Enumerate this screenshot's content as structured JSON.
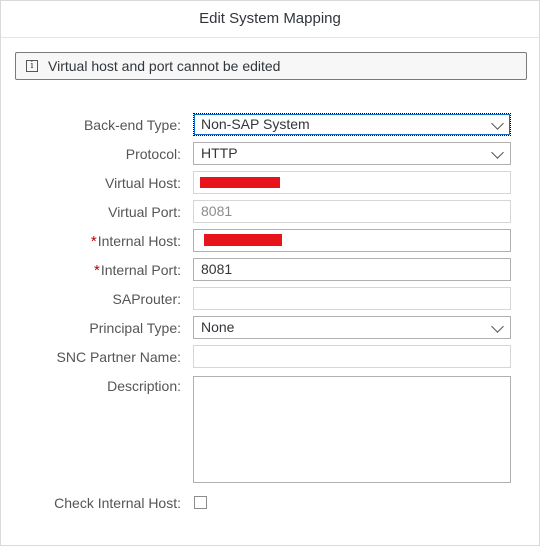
{
  "dialog": {
    "title": "Edit System Mapping",
    "info": {
      "icon": "info-icon",
      "text": "Virtual host and port cannot be edited"
    }
  },
  "form": {
    "backend_type": {
      "label": "Back-end Type:",
      "value": "Non-SAP System"
    },
    "protocol": {
      "label": "Protocol:",
      "value": "HTTP"
    },
    "virtual_host": {
      "label": "Virtual Host:",
      "value": ""
    },
    "virtual_port": {
      "label": "Virtual Port:",
      "value": "8081"
    },
    "internal_host": {
      "label": "Internal Host:",
      "required": "*",
      "value": ""
    },
    "internal_port": {
      "label": "Internal Port:",
      "required": "*",
      "value": "8081"
    },
    "saprouter": {
      "label": "SAProuter:",
      "value": ""
    },
    "principal_type": {
      "label": "Principal Type:",
      "value": "None"
    },
    "snc_partner_name": {
      "label": "SNC Partner Name:",
      "value": ""
    },
    "description": {
      "label": "Description:",
      "value": ""
    },
    "check_internal_host": {
      "label": "Check Internal Host:",
      "checked": false
    }
  },
  "colors": {
    "required_marker": "#bb0000",
    "redaction": "#e8141c",
    "focus_outline": "#0a6ed1"
  }
}
